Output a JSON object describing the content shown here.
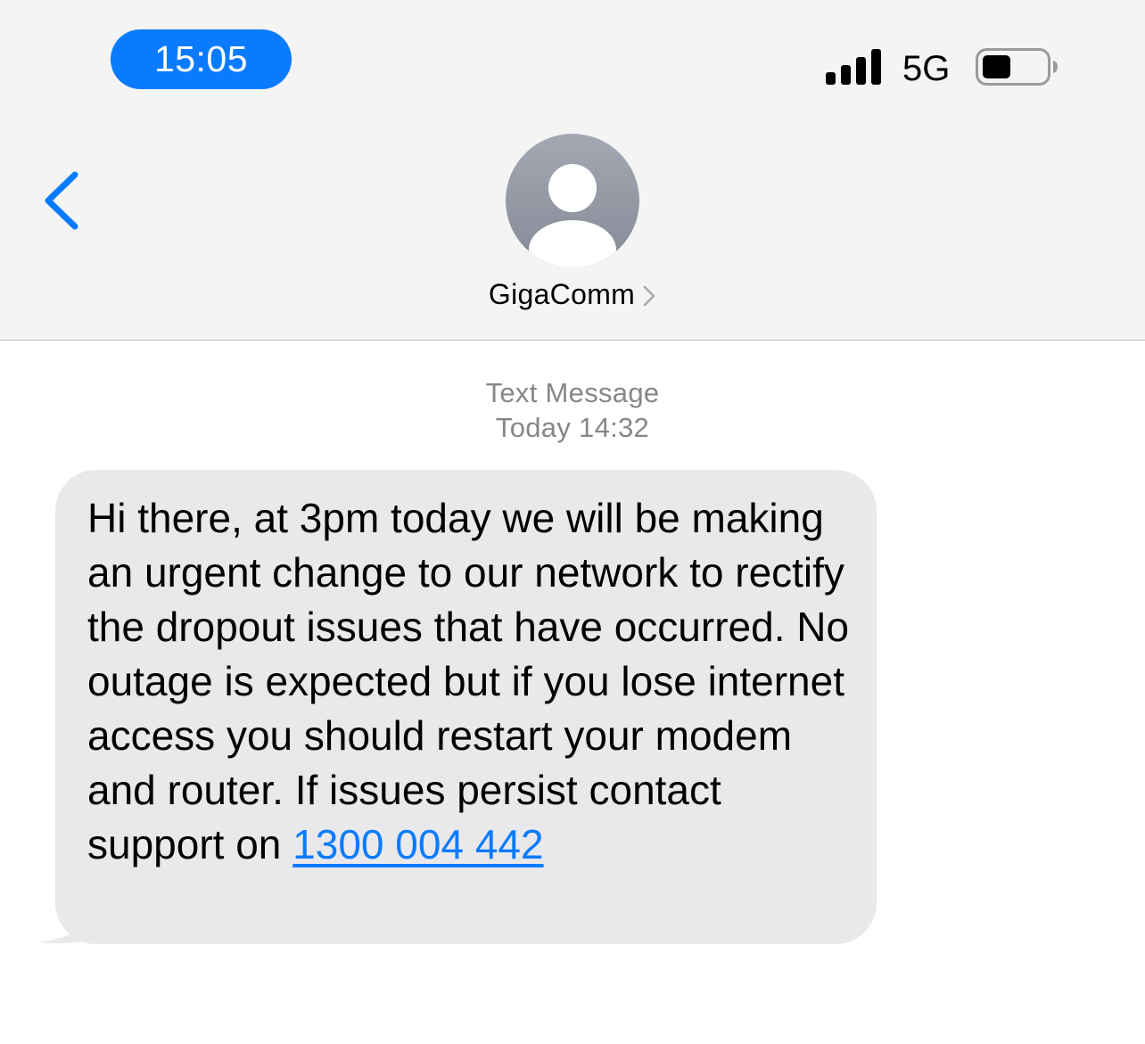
{
  "status_bar": {
    "time": "15:05",
    "network": "5G",
    "signal_icon": "signal-bars-icon",
    "battery_icon": "battery-icon",
    "battery_level": 0.45
  },
  "header": {
    "back_icon": "chevron-left-icon",
    "avatar_icon": "person-avatar-icon",
    "contact_name": "GigaComm",
    "contact_chevron_icon": "chevron-right-icon"
  },
  "thread": {
    "meta_label": "Text Message",
    "meta_time": "Today 14:32",
    "message": {
      "text": "Hi there, at 3pm today we will be making an urgent change to our network to rectify the dropout issues that have occurred. No outage is expected but if you lose internet access you should restart your modem and router. If issues persist contact support on ",
      "phone": "1300 004 442"
    }
  },
  "colors": {
    "accent": "#0a7bff",
    "bubble": "#e9e9eb",
    "header_bg": "#f4f4f4",
    "meta_text": "#86868b"
  }
}
